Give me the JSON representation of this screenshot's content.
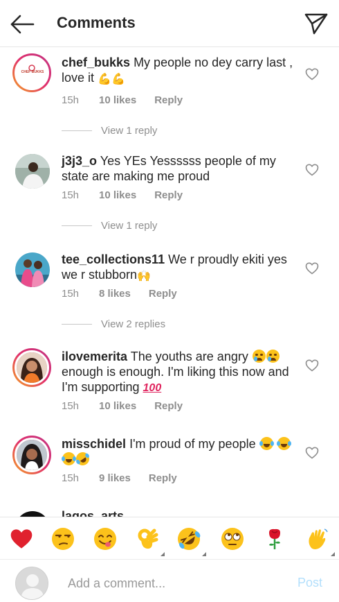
{
  "header": {
    "title": "Comments",
    "back_icon": "arrow-left-icon",
    "send_icon": "paper-plane-icon"
  },
  "comments": [
    {
      "username": "chef_bukks",
      "text": "My people no dey carry last , love it",
      "emojis": [
        "flexed-biceps",
        "flexed-biceps"
      ],
      "avatar_caption": "CHEF BUKKS",
      "time": "15h",
      "likes": "10 likes",
      "reply": "Reply",
      "view_replies": "View 1 reply"
    },
    {
      "username": "j3j3_o",
      "text": "Yes YEs Yessssss  people of my state are making me proud",
      "emojis": [],
      "time": "15h",
      "likes": "10 likes",
      "reply": "Reply",
      "view_replies": "View 1 reply"
    },
    {
      "username": "tee_collections11",
      "text": "We r proudly ekiti yes we r stubborn",
      "emojis": [
        "raising-hands"
      ],
      "time": "15h",
      "likes": "8 likes",
      "reply": "Reply",
      "view_replies": "View 2 replies"
    },
    {
      "username": "ilovemerita",
      "text_a": "The youths are angry",
      "text_b": "enough is enough. I'm liking this now and I'm supporting",
      "emojis_a": [
        "crying-face",
        "crying-face"
      ],
      "emojis_b": [
        "hundred-points"
      ],
      "hundred": "100",
      "time": "15h",
      "likes": "10 likes",
      "reply": "Reply"
    },
    {
      "username": "misschidel",
      "text": "I'm proud of my people",
      "emojis": [
        "tears-of-joy",
        "tears-of-joy",
        "tears-of-joy",
        "rolling-on-floor-laughing"
      ],
      "time": "15h",
      "likes": "9 likes",
      "reply": "Reply"
    },
    {
      "username": "lagos_arts",
      "text": ""
    }
  ],
  "emoji_bar": [
    {
      "name": "red-heart",
      "char": "❤"
    },
    {
      "name": "unamused-face",
      "char": "😒"
    },
    {
      "name": "face-savoring-food",
      "char": "😋"
    },
    {
      "name": "ok-hand",
      "char": "👌"
    },
    {
      "name": "rolling-on-floor-laughing",
      "char": "🤣"
    },
    {
      "name": "face-with-rolling-eyes",
      "char": "🙄"
    },
    {
      "name": "rose",
      "char": "🌹"
    },
    {
      "name": "waving-hand",
      "char": "👋"
    }
  ],
  "composer": {
    "placeholder": "Add a comment...",
    "post_label": "Post"
  },
  "colors": {
    "text": "#262626",
    "muted": "#8e8e8e",
    "post_disabled": "#b2dffc",
    "story_ring_start": "#f5a623",
    "story_ring_end": "#c13584"
  }
}
